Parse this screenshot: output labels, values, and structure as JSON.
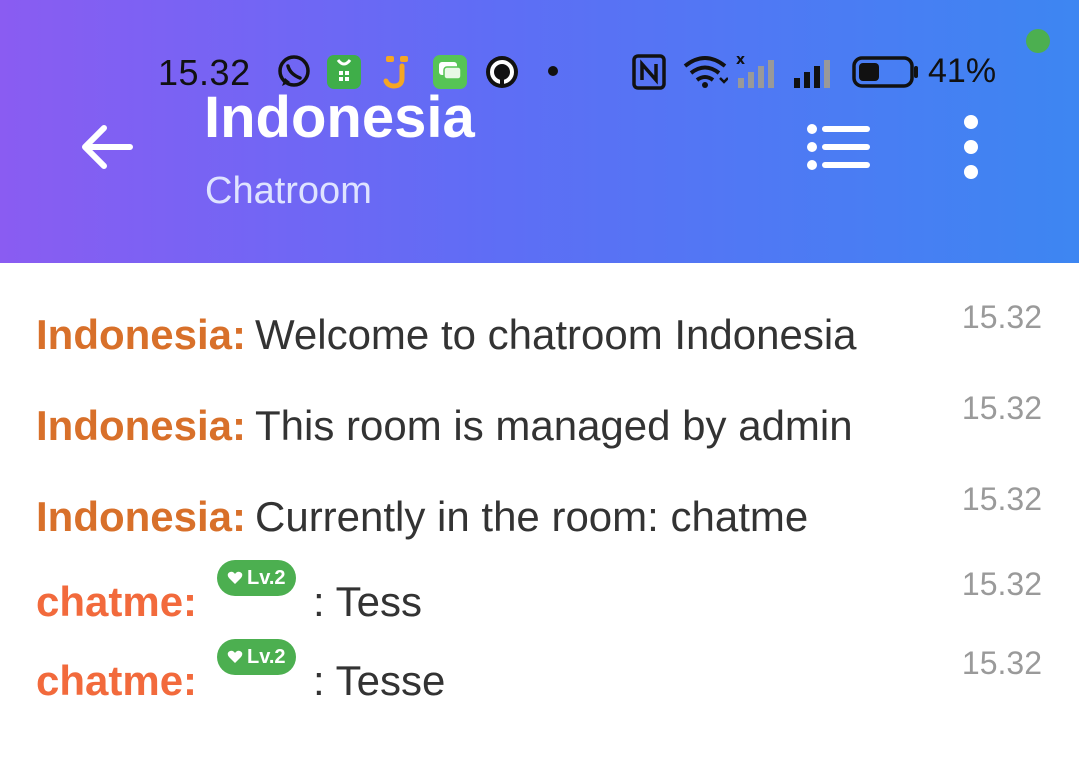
{
  "status_bar": {
    "time": "15.32",
    "battery_percent": "41%",
    "battery_level": 0.41,
    "icons": [
      "whatsapp-icon",
      "app-green-icon",
      "app-j-icon",
      "messages-icon",
      "app-circle-icon",
      "dot-icon",
      "nfc-icon",
      "wifi-icon",
      "signal-1-icon",
      "signal-2-icon",
      "battery-icon"
    ]
  },
  "header": {
    "title": "Indonesia",
    "subtitle": "Chatroom",
    "back_icon": "arrow-left-icon",
    "list_icon": "list-icon",
    "more_icon": "more-vertical-icon"
  },
  "colors": {
    "header_gradient_start": "#8a5cf2",
    "header_gradient_end": "#3d86f2",
    "room_sender": "#d8702a",
    "user_sender": "#f26a3c",
    "badge": "#4caf50"
  },
  "messages": [
    {
      "sender": "Indonesia:",
      "text": "Welcome to chatroom Indonesia",
      "time": "15.32"
    },
    {
      "sender": "Indonesia:",
      "text": "This room is managed by admin",
      "time": "15.32"
    },
    {
      "sender": "Indonesia:",
      "text": "Currently in the room: chatme",
      "time": "15.32"
    },
    {
      "sender": "chatme:",
      "badge": "Lv.2",
      "text": ": Tess",
      "time": "15.32"
    },
    {
      "sender": "chatme:",
      "badge": "Lv.2",
      "text": ": Tesse",
      "time": "15.32"
    }
  ]
}
